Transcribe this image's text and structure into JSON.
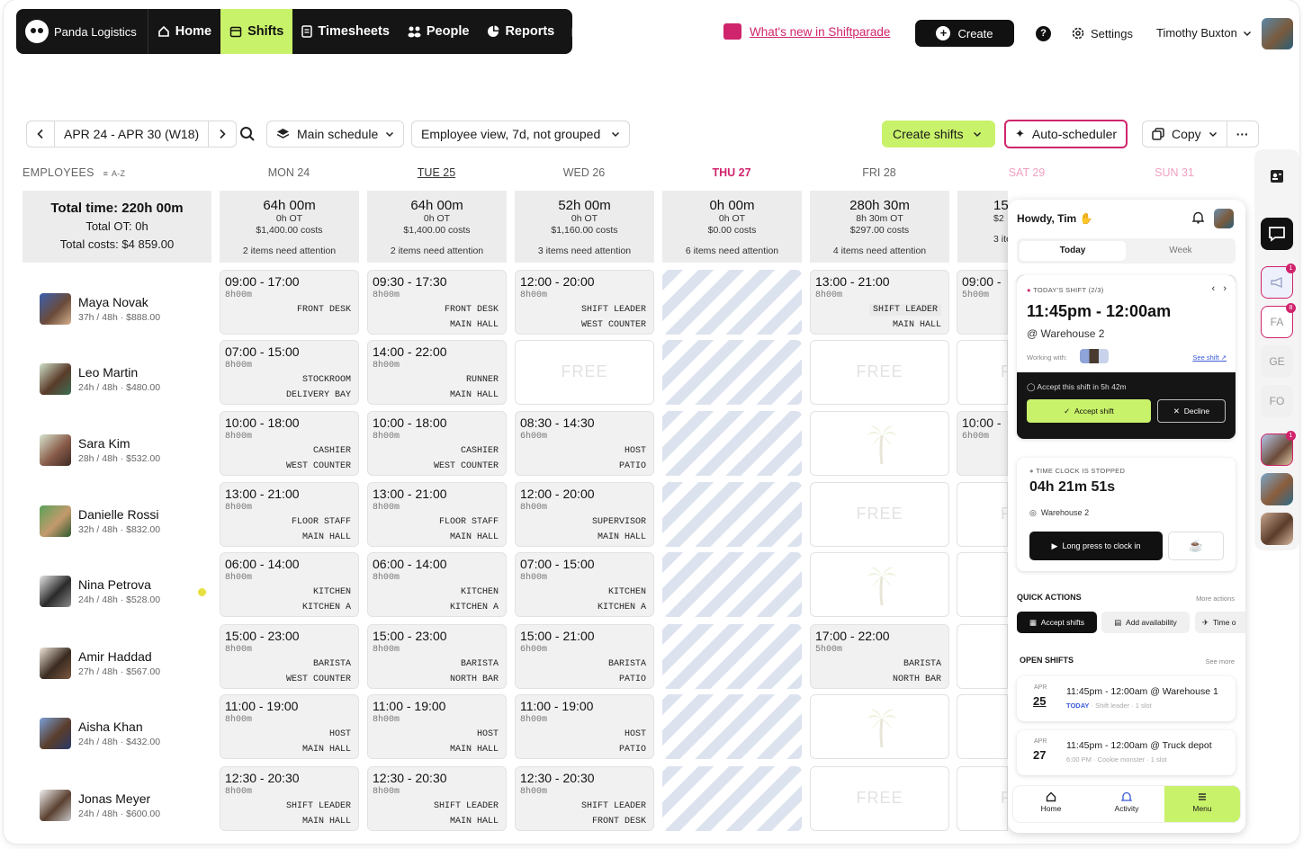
{
  "nav": {
    "brand": "Panda Logistics",
    "items": [
      {
        "label": "Home",
        "icon": "home-icon"
      },
      {
        "label": "Shifts",
        "icon": "calendar-icon"
      },
      {
        "label": "Timesheets",
        "icon": "timesheet-icon"
      },
      {
        "label": "People",
        "icon": "people-icon"
      },
      {
        "label": "Reports",
        "icon": "reports-icon"
      }
    ]
  },
  "header": {
    "whats_new": "What's new in Shiftparade",
    "create": "Create",
    "help": "?",
    "settings": "Settings",
    "user": "Timothy Buxton"
  },
  "toolbar": {
    "date_range": "APR 24 - APR 30 (W18)",
    "schedule": "Main schedule",
    "view": "Employee view, 7d, not grouped",
    "create_shifts": "Create shifts",
    "auto_scheduler": "Auto-scheduler",
    "copy": "Copy",
    "more": "···"
  },
  "grid": {
    "employees_label": "EMPLOYEES",
    "sort_label": "A-Z",
    "days": [
      "MON 24",
      "TUE 25",
      "WED 26",
      "THU 27",
      "FRI 28",
      "SAT 29",
      "SUN 31"
    ],
    "total": {
      "time": "Total time: 220h 00m",
      "ot": "Total OT: 0h",
      "costs": "Total costs: $4 859.00"
    },
    "summaries": [
      {
        "time": "64h 00m",
        "ot": "0h OT",
        "costs": "$1,400.00 costs",
        "attention": "2 items need attention"
      },
      {
        "time": "64h 00m",
        "ot": "0h OT",
        "costs": "$1,400.00 costs",
        "attention": "2 items need attention"
      },
      {
        "time": "52h 00m",
        "ot": "0h OT",
        "costs": "$1,160.00 costs",
        "attention": "3 items need attention"
      },
      {
        "time": "0h 00m",
        "ot": "0h OT",
        "costs": "$0.00 costs",
        "attention": "6 items need attention"
      },
      {
        "time": "280h 30m",
        "ot": "8h 30m OT",
        "costs": "$297.00 costs",
        "attention": "4 items need attention"
      },
      {
        "time": "15",
        "ot": "",
        "costs": "$2",
        "attention": "3 items"
      }
    ],
    "free_label": "FREE",
    "employees": [
      {
        "name": "Maya Novak",
        "meta": "37h / 48h · $888.00",
        "shifts": [
          {
            "time": "09:00 - 17:00",
            "dur": "8h00m",
            "role": "FRONT DESK",
            "area": ""
          },
          {
            "time": "09:30 - 17:30",
            "dur": "8h00m",
            "role": "FRONT DESK",
            "area": "MAIN HALL"
          },
          {
            "time": "12:00 - 20:00",
            "dur": "8h00m",
            "role": "SHIFT LEADER",
            "area": "WEST COUNTER"
          },
          null,
          {
            "time": "13:00 - 21:00",
            "dur": "8h00m",
            "role": "SHIFT LEADER",
            "area": "MAIN HALL"
          }
        ],
        "sat": {
          "time": "09:00 -",
          "dur": "5h00m"
        }
      },
      {
        "name": "Leo Martin",
        "meta": "24h / 48h · $480.00",
        "shifts": [
          {
            "time": "07:00 - 15:00",
            "dur": "8h00m",
            "role": "STOCKROOM",
            "area": "DELIVERY BAY"
          },
          {
            "time": "14:00 - 22:00",
            "dur": "8h00m",
            "role": "RUNNER",
            "area": "MAIN HALL"
          },
          "free",
          null,
          "free"
        ],
        "sat": null
      },
      {
        "name": "Sara Kim",
        "meta": "28h / 48h · $532.00",
        "shifts": [
          {
            "time": "10:00 - 18:00",
            "dur": "8h00m",
            "role": "CASHIER",
            "area": "WEST COUNTER"
          },
          {
            "time": "10:00 - 18:00",
            "dur": "8h00m",
            "role": "CASHIER",
            "area": "WEST COUNTER"
          },
          {
            "time": "08:30 - 14:30",
            "dur": "6h00m",
            "role": "HOST",
            "area": "PATIO"
          },
          null,
          "palm"
        ],
        "sat": {
          "time": "10:00 -",
          "dur": "6h00m"
        }
      },
      {
        "name": "Danielle Rossi",
        "meta": "32h / 48h · $832.00",
        "shifts": [
          {
            "time": "13:00 - 21:00",
            "dur": "8h00m",
            "role": "FLOOR STAFF",
            "area": "MAIN HALL"
          },
          {
            "time": "13:00 - 21:00",
            "dur": "8h00m",
            "role": "FLOOR STAFF",
            "area": "MAIN HALL"
          },
          {
            "time": "12:00 - 20:00",
            "dur": "8h00m",
            "role": "SUPERVISOR",
            "area": "MAIN HALL"
          },
          null,
          "free"
        ],
        "sat": null
      },
      {
        "name": "Nina Petrova",
        "meta": "24h / 48h · $528.00",
        "shifts": [
          {
            "time": "06:00 - 14:00",
            "dur": "8h00m",
            "role": "KITCHEN",
            "area": "KITCHEN A"
          },
          {
            "time": "06:00 - 14:00",
            "dur": "8h00m",
            "role": "KITCHEN",
            "area": "KITCHEN A"
          },
          {
            "time": "07:00 - 15:00",
            "dur": "8h00m",
            "role": "KITCHEN",
            "area": "KITCHEN A"
          },
          null,
          "palm"
        ],
        "sat": null
      },
      {
        "name": "Amir Haddad",
        "meta": "27h / 48h · $567.00",
        "shifts": [
          {
            "time": "15:00 - 23:00",
            "dur": "8h00m",
            "role": "BARISTA",
            "area": "WEST COUNTER"
          },
          {
            "time": "15:00 - 23:00",
            "dur": "8h00m",
            "role": "BARISTA",
            "area": "NORTH BAR"
          },
          {
            "time": "15:00 - 21:00",
            "dur": "6h00m",
            "role": "BARISTA",
            "area": "PATIO"
          },
          null,
          {
            "time": "17:00 - 22:00",
            "dur": "5h00m",
            "role": "BARISTA",
            "area": "NORTH BAR"
          }
        ],
        "sat": null
      },
      {
        "name": "Aisha Khan",
        "meta": "24h / 48h · $432.00",
        "shifts": [
          {
            "time": "11:00 - 19:00",
            "dur": "8h00m",
            "role": "HOST",
            "area": "MAIN HALL"
          },
          {
            "time": "11:00 - 19:00",
            "dur": "8h00m",
            "role": "HOST",
            "area": "MAIN HALL"
          },
          {
            "time": "11:00 - 19:00",
            "dur": "8h00m",
            "role": "HOST",
            "area": "PATIO"
          },
          null,
          "palm"
        ],
        "sat": null
      },
      {
        "name": "Jonas Meyer",
        "meta": "24h / 48h · $600.00",
        "shifts": [
          {
            "time": "12:30 - 20:30",
            "dur": "8h00m",
            "role": "SHIFT LEADER",
            "area": "MAIN HALL"
          },
          {
            "time": "12:30 - 20:30",
            "dur": "8h00m",
            "role": "SHIFT LEADER",
            "area": "MAIN HALL"
          },
          {
            "time": "12:30 - 20:30",
            "dur": "8h00m",
            "role": "SHIFT LEADER",
            "area": "FRONT DESK"
          },
          null,
          "free"
        ],
        "sat": null
      }
    ]
  },
  "panel": {
    "greeting": "Howdy, Tim",
    "tabs": [
      "Today",
      "Week"
    ],
    "todays_shift": {
      "label": "TODAY'S SHIFT (2/3)",
      "time": "11:45pm - 12:00am",
      "location": "@ Warehouse 2",
      "working_with": "Working with:",
      "see_shift": "See shift",
      "accept_prompt": "Accept this shift in 5h 42m",
      "accept": "Accept shift",
      "decline": "Decline"
    },
    "time_clock": {
      "label": "TIME CLOCK IS STOPPED",
      "time": "04h 21m 51s",
      "location": "Warehouse 2",
      "clock_in": "Long press to clock in"
    },
    "quick_actions": {
      "title": "QUICK ACTIONS",
      "more": "More actions",
      "items": [
        "Accept shifts",
        "Add availability",
        "Time o"
      ]
    },
    "open_shifts": {
      "title": "OPEN SHIFTS",
      "more": "See more",
      "items": [
        {
          "month": "APR",
          "day": "25",
          "title": "11:45pm - 12:00am @ Warehouse 1",
          "tag": "TODAY",
          "sub": " · Shift leader · 1 slot"
        },
        {
          "month": "APR",
          "day": "27",
          "title": "11:45pm - 12:00am @ Truck depot",
          "tag": "",
          "sub": "6:00 PM · Cookie monster · 1 slot"
        }
      ]
    },
    "bottom_nav": [
      "Home",
      "Activity",
      "Menu"
    ]
  },
  "rail": {
    "badges": [
      "1",
      "8",
      "1"
    ],
    "initials": [
      "FA",
      "GE",
      "FO"
    ]
  },
  "colors": {
    "accent": "#c9f26b",
    "brand_pink": "#d0246c",
    "dark": "#151515"
  }
}
